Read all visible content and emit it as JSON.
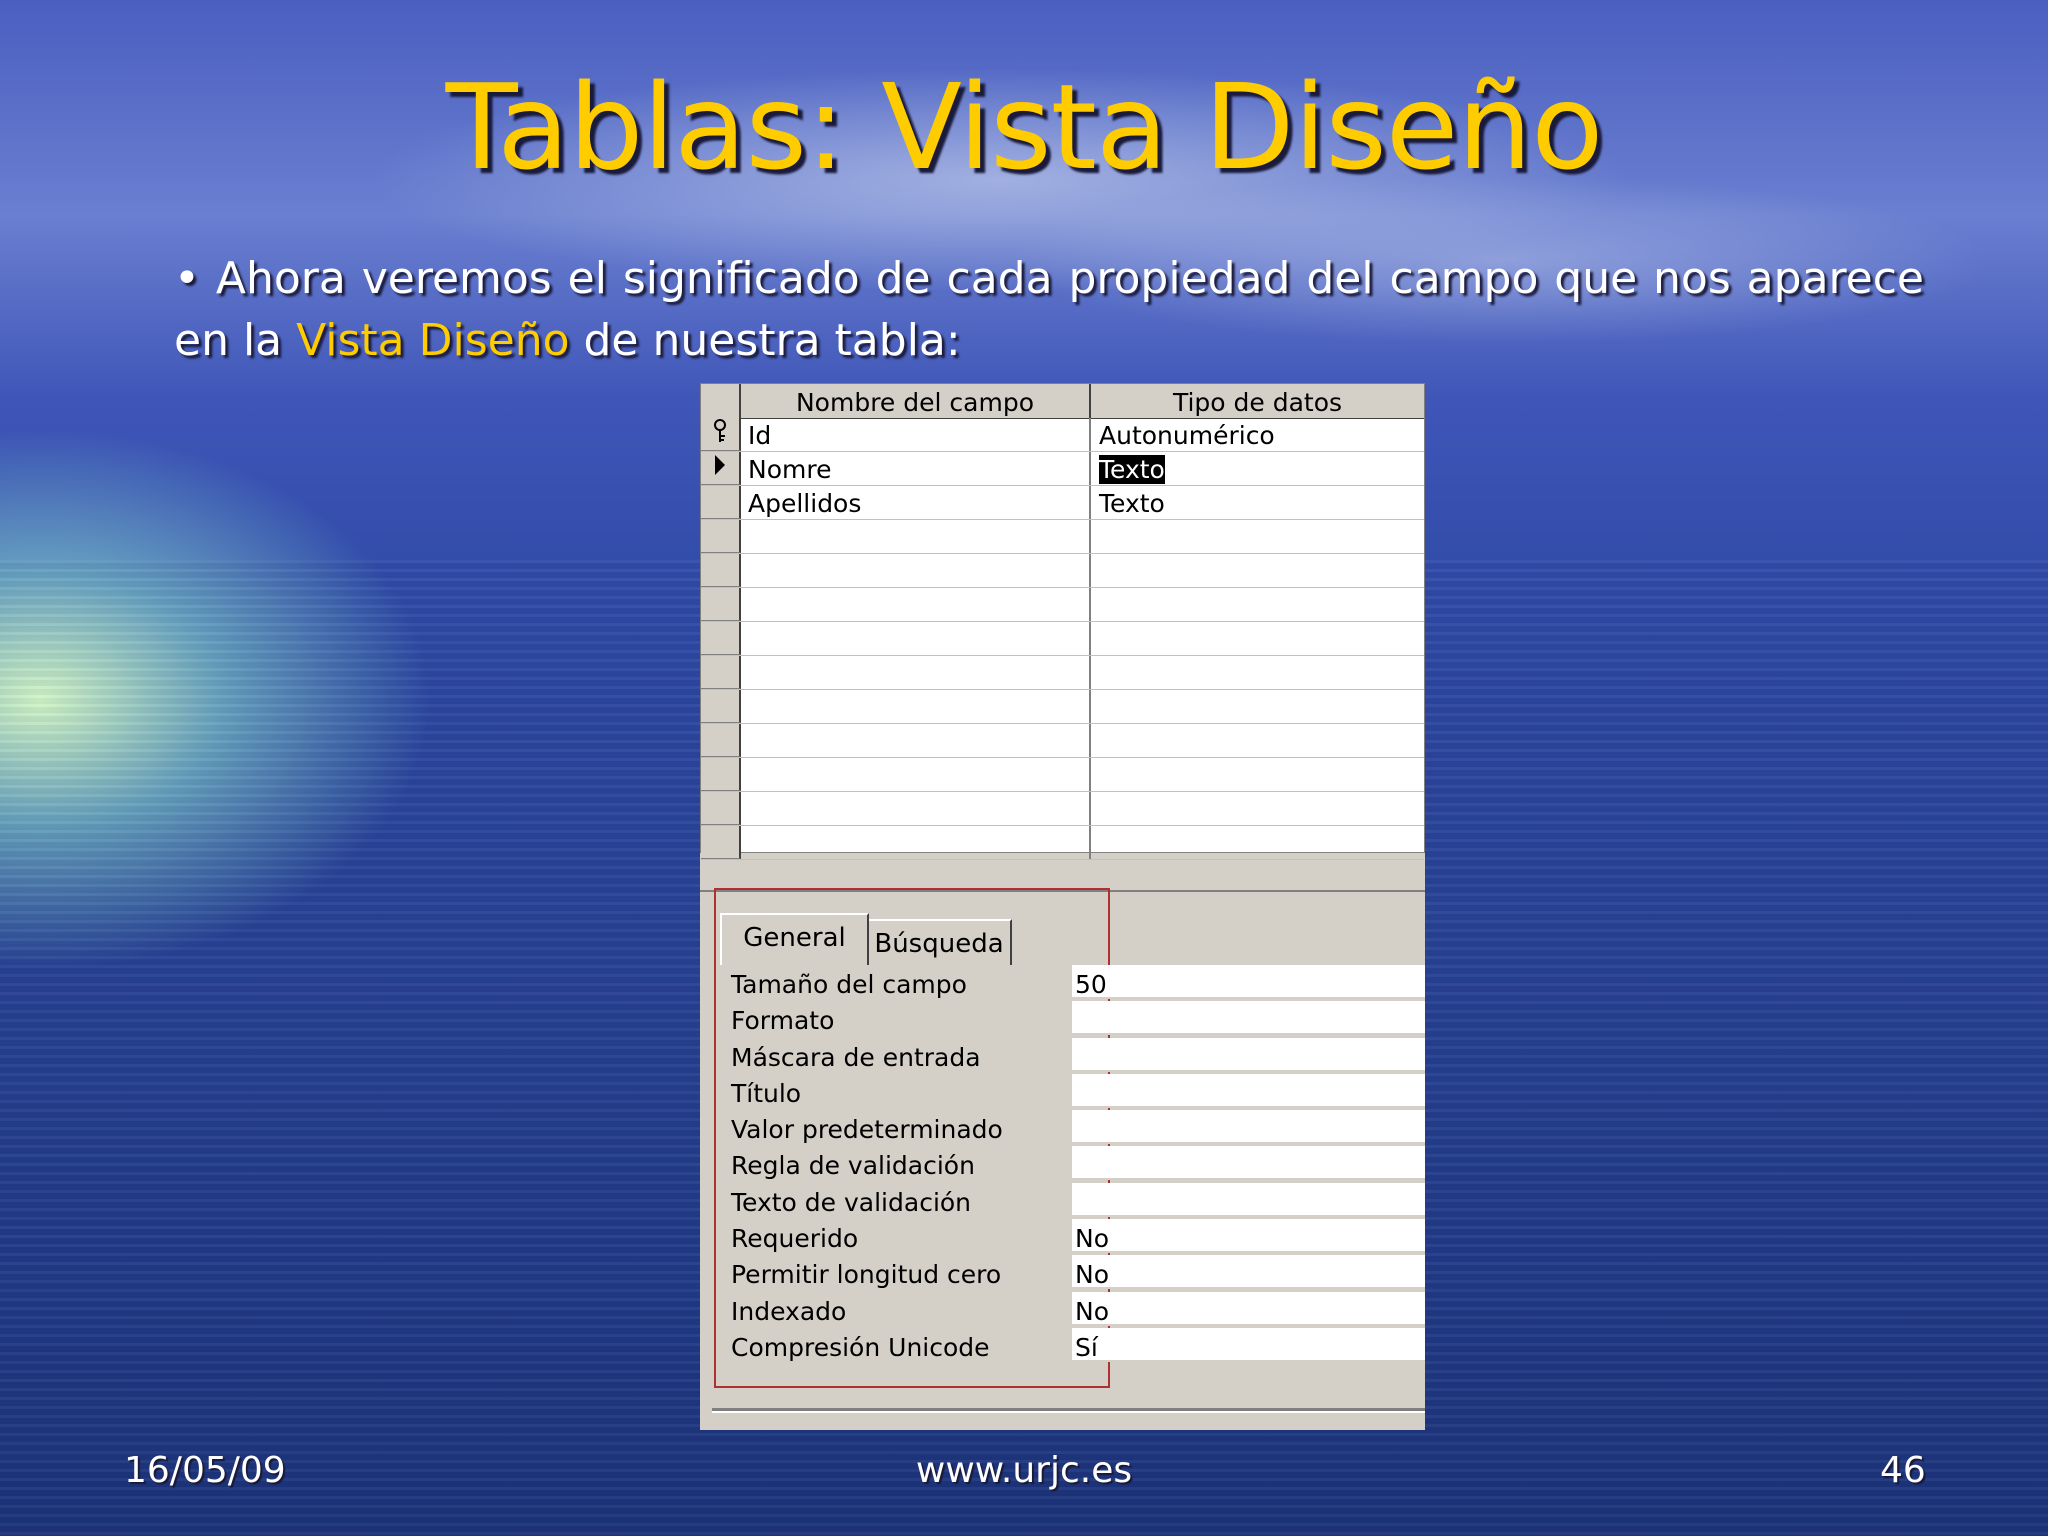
{
  "slide": {
    "title": "Tablas: Vista Diseño",
    "bullet_symbol": "•",
    "bullet_before": "Ahora veremos el significado de cada propiedad del campo que nos aparece en la ",
    "bullet_highlight": "Vista Diseño",
    "bullet_after": " de nuestra tabla:",
    "highlight_color": "#ffcc00"
  },
  "design_grid": {
    "columns": [
      "Nombre del campo",
      "Tipo de datos"
    ],
    "rows": [
      {
        "name": "Id",
        "type": "Autonumérico",
        "indicator": "key-icon"
      },
      {
        "name": "Nomre",
        "type": "Texto",
        "indicator": "current-row-arrow-icon",
        "type_selected": true
      },
      {
        "name": "Apellidos",
        "type": "Texto",
        "indicator": ""
      }
    ]
  },
  "properties": {
    "tabs": [
      "General",
      "Búsqueda"
    ],
    "active_tab": "General",
    "items": [
      {
        "label": "Tamaño del campo",
        "value": "50"
      },
      {
        "label": "Formato",
        "value": ""
      },
      {
        "label": "Máscara de entrada",
        "value": ""
      },
      {
        "label": "Título",
        "value": ""
      },
      {
        "label": "Valor predeterminado",
        "value": ""
      },
      {
        "label": "Regla de validación",
        "value": ""
      },
      {
        "label": "Texto de validación",
        "value": ""
      },
      {
        "label": "Requerido",
        "value": "No"
      },
      {
        "label": "Permitir longitud cero",
        "value": "No"
      },
      {
        "label": "Indexado",
        "value": "No"
      },
      {
        "label": "Compresión Unicode",
        "value": "Sí"
      }
    ]
  },
  "footer": {
    "date": "16/05/09",
    "site": "www.urjc.es",
    "page": "46"
  }
}
